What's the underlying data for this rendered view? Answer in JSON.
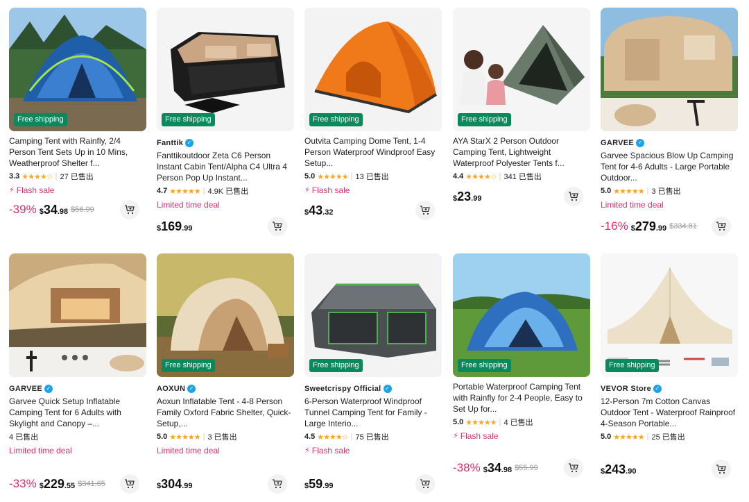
{
  "colors": {
    "accent": "#e02e6b",
    "shipping_badge": "#0a8a5c",
    "star": "#f5a623",
    "verified": "#1aa3e8"
  },
  "icons": {
    "flash": "lightning-icon",
    "cart": "add-to-cart-icon",
    "verified": "verified-check-icon"
  },
  "products": [
    {
      "title": "Camping Tent with Rainfly, 2/4 Person Tent Sets Up in 10 Mins, Weatherproof Shelter f...",
      "store": "",
      "badge": "Free shipping",
      "score": "3.3",
      "stars": "★★★★☆",
      "sold": "27 已售出",
      "promo": "Flash sale",
      "discount": "-39%",
      "price_int": "34",
      "price_cents": ".98",
      "orig": "$56.99"
    },
    {
      "title": "Fanttikoutdoor Zeta C6 Person Instant Cabin Tent/Alpha C4 Ultra 4 Person Pop Up Instant...",
      "store": "Fanttik",
      "badge": "Free shipping",
      "score": "4.7",
      "stars": "★★★★★",
      "sold": "4.9K 已售出",
      "promo": "Limited time deal",
      "discount": "",
      "price_int": "169",
      "price_cents": ".99",
      "orig": ""
    },
    {
      "title": "Outvita Camping Dome Tent, 1-4 Person Waterproof Windproof Easy Setup...",
      "store": "",
      "badge": "Free shipping",
      "score": "5.0",
      "stars": "★★★★★",
      "sold": "13 已售出",
      "promo": "Flash sale",
      "discount": "",
      "price_int": "43",
      "price_cents": ".32",
      "orig": ""
    },
    {
      "title": "AYA StarX 2 Person Outdoor Camping Tent, Lightweight Waterproof Polyester Tents f...",
      "store": "",
      "badge": "Free shipping",
      "score": "4.4",
      "stars": "★★★★☆",
      "sold": "341 已售出",
      "promo": "",
      "discount": "",
      "price_int": "23",
      "price_cents": ".99",
      "orig": ""
    },
    {
      "title": "Garvee Spacious Blow Up Camping Tent for 4-6 Adults - Large Portable Outdoor...",
      "store": "GARVEE",
      "badge": "",
      "score": "5.0",
      "stars": "★★★★★",
      "sold": "3 已售出",
      "promo": "Limited time deal",
      "discount": "-16%",
      "price_int": "279",
      "price_cents": ".99",
      "orig": "$334.81"
    },
    {
      "title": "Garvee Quick Setup Inflatable Camping Tent for 6 Adults with Skylight and Canopy –...",
      "store": "GARVEE",
      "badge": "",
      "score": "",
      "stars": "",
      "sold": "4 已售出",
      "promo": "Limited time deal",
      "discount": "-33%",
      "price_int": "229",
      "price_cents": ".55",
      "orig": "$341.65"
    },
    {
      "title": "Aoxun Inflatable Tent - 4-8 Person Family Oxford Fabric Shelter, Quick-Setup,...",
      "store": "AOXUN",
      "badge": "Free shipping",
      "score": "5.0",
      "stars": "★★★★★",
      "sold": "3 已售出",
      "promo": "Limited time deal",
      "discount": "",
      "price_int": "304",
      "price_cents": ".99",
      "orig": ""
    },
    {
      "title": "6-Person Waterproof Windproof Tunnel Camping Tent for Family - Large Interio...",
      "store": "Sweetcrispy Official",
      "badge": "Free shipping",
      "score": "4.5",
      "stars": "★★★★☆",
      "sold": "75 已售出",
      "promo": "Flash sale",
      "discount": "",
      "price_int": "59",
      "price_cents": ".99",
      "orig": ""
    },
    {
      "title": "Portable Waterproof Camping Tent with Rainfly for 2-4 People, Easy to Set Up for...",
      "store": "",
      "badge": "Free shipping",
      "score": "5.0",
      "stars": "★★★★★",
      "sold": "4 已售出",
      "promo": "Flash sale",
      "discount": "-38%",
      "price_int": "34",
      "price_cents": ".98",
      "orig": "$55.99"
    },
    {
      "title": "12-Person 7m Cotton Canvas Outdoor Tent - Waterproof Rainproof 4-Season Portable...",
      "store": "VEVOR Store",
      "badge": "Free shipping",
      "score": "5.0",
      "stars": "★★★★★",
      "sold": "25 已售出",
      "promo": "",
      "discount": "",
      "price_int": "243",
      "price_cents": ".90",
      "orig": ""
    }
  ]
}
